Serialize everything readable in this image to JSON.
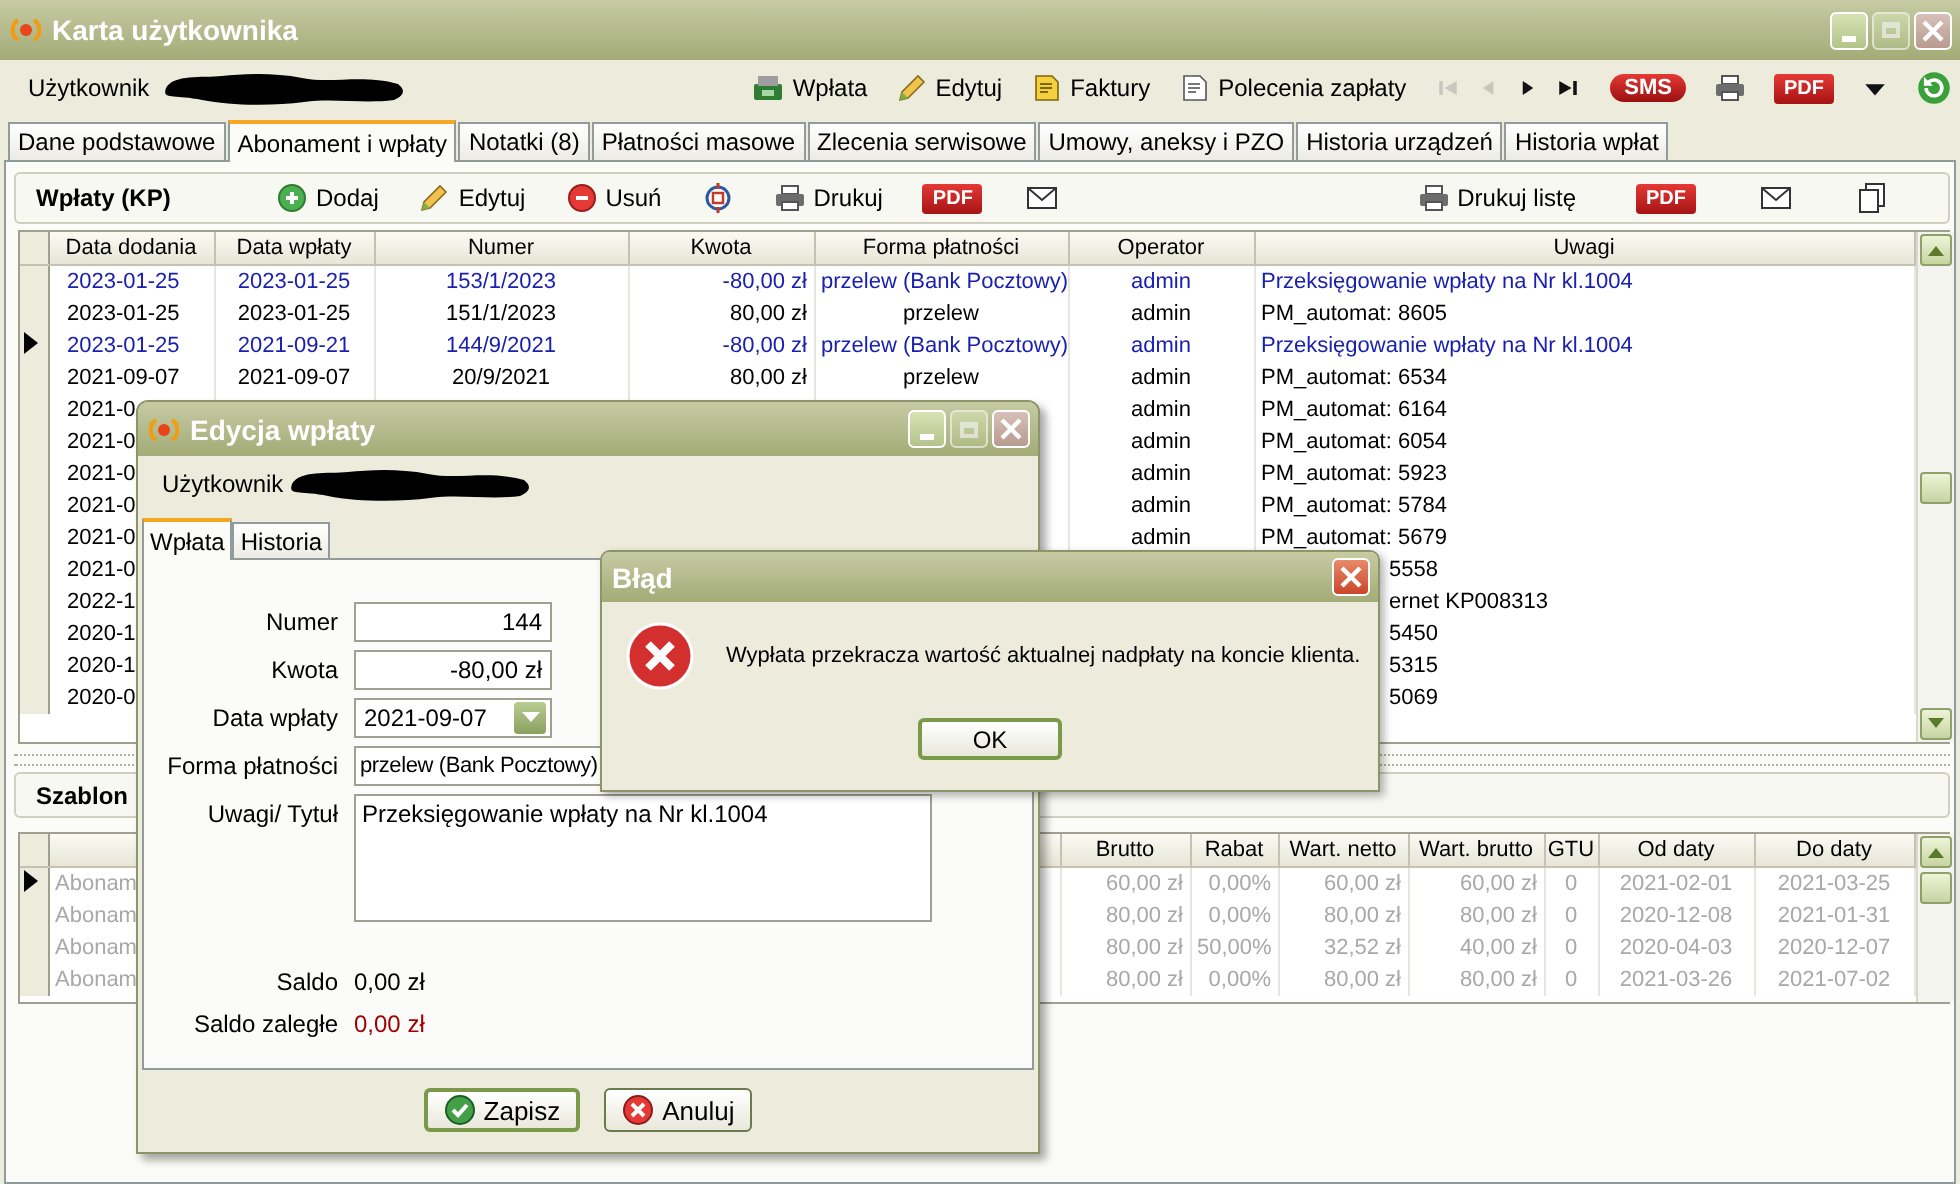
{
  "window": {
    "title": "Karta użytkownika"
  },
  "toolbar": {
    "user_label": "Użytkownik",
    "buttons": [
      {
        "kind": "payment",
        "label": "Wpłata"
      },
      {
        "kind": "edit",
        "label": "Edytuj"
      },
      {
        "kind": "invoices",
        "label": "Faktury"
      },
      {
        "kind": "orders",
        "label": "Polecenia zapłaty"
      }
    ],
    "nav_buttons": [
      {
        "kind": "first",
        "disabled": true
      },
      {
        "kind": "prev",
        "disabled": true
      },
      {
        "kind": "next",
        "disabled": false
      },
      {
        "kind": "last",
        "disabled": false
      }
    ],
    "sms_label": "SMS",
    "pdf_label": "PDF"
  },
  "tabs": [
    {
      "label": "Dane podstawowe",
      "selected": false
    },
    {
      "label": "Abonament i wpłaty",
      "selected": true
    },
    {
      "label": "Notatki (8)",
      "selected": false
    },
    {
      "label": "Płatności masowe",
      "selected": false
    },
    {
      "label": "Zlecenia serwisowe",
      "selected": false
    },
    {
      "label": "Umowy, aneksy i PZO",
      "selected": false
    },
    {
      "label": "Historia urządzeń",
      "selected": false
    },
    {
      "label": "Historia wpłat",
      "selected": false
    }
  ],
  "payments": {
    "title": "Wpłaty (KP)",
    "actions_left": [
      {
        "kind": "add",
        "label": "Dodaj"
      },
      {
        "kind": "edit",
        "label": "Edytuj"
      },
      {
        "kind": "delete",
        "label": "Usuń"
      },
      {
        "kind": "sync"
      },
      {
        "kind": "print",
        "label": "Drukuj"
      },
      {
        "kind": "pdf",
        "label": "PDF"
      },
      {
        "kind": "mail"
      }
    ],
    "actions_right": [
      {
        "kind": "print",
        "label": "Drukuj listę"
      },
      {
        "kind": "pdf",
        "label": "PDF"
      },
      {
        "kind": "mail"
      },
      {
        "kind": "copy"
      }
    ],
    "columns": [
      "Data dodania",
      "Data wpłaty",
      "Numer",
      "Kwota",
      "Forma płatności",
      "Operator",
      "Uwagi"
    ],
    "rows": [
      {
        "kind": "rebooking",
        "current": false,
        "cells": [
          "2023-01-25",
          "2023-01-25",
          "153/1/2023",
          "-80,00 zł",
          "przelew (Bank Pocztowy)",
          "admin",
          "Przeksięgowanie wpłaty na Nr kl.1004"
        ]
      },
      {
        "kind": "normal",
        "current": false,
        "cells": [
          "2023-01-25",
          "2023-01-25",
          "151/1/2023",
          "80,00 zł",
          "przelew",
          "admin",
          "PM_automat: 8605"
        ]
      },
      {
        "kind": "rebooking",
        "current": true,
        "cells": [
          "2023-01-25",
          "2021-09-21",
          "144/9/2021",
          "-80,00 zł",
          "przelew (Bank Pocztowy)",
          "admin",
          "Przeksięgowanie wpłaty na Nr kl.1004"
        ]
      },
      {
        "kind": "normal",
        "current": false,
        "cells": [
          "2021-09-07",
          "2021-09-07",
          "20/9/2021",
          "80,00 zł",
          "przelew",
          "admin",
          "PM_automat: 6534"
        ]
      },
      {
        "kind": "normal",
        "current": false,
        "cells": [
          "2021-0",
          null,
          null,
          null,
          null,
          "admin",
          "PM_automat: 6164"
        ]
      },
      {
        "kind": "normal",
        "current": false,
        "cells": [
          "2021-0",
          null,
          null,
          null,
          null,
          "admin",
          "PM_automat: 6054"
        ]
      },
      {
        "kind": "normal",
        "current": false,
        "cells": [
          "2021-0",
          null,
          null,
          null,
          null,
          "admin",
          "PM_automat: 5923"
        ]
      },
      {
        "kind": "normal",
        "current": false,
        "cells": [
          "2021-0",
          null,
          null,
          null,
          null,
          "admin",
          "PM_automat: 5784"
        ]
      },
      {
        "kind": "normal",
        "current": false,
        "cells": [
          "2021-0",
          null,
          null,
          null,
          null,
          "admin",
          "PM_automat: 5679"
        ]
      },
      {
        "kind": "normal",
        "current": false,
        "cells": [
          "2021-0",
          null,
          null,
          null,
          null,
          null,
          "5558"
        ]
      },
      {
        "kind": "normal",
        "current": false,
        "cells": [
          "2022-1",
          null,
          null,
          null,
          null,
          null,
          "ernet KP008313"
        ]
      },
      {
        "kind": "normal",
        "current": false,
        "cells": [
          "2020-1",
          null,
          null,
          null,
          null,
          null,
          "5450"
        ]
      },
      {
        "kind": "normal",
        "current": false,
        "cells": [
          "2020-1",
          null,
          null,
          null,
          null,
          null,
          "5315"
        ]
      },
      {
        "kind": "normal",
        "current": false,
        "cells": [
          "2020-0",
          null,
          null,
          null,
          null,
          null,
          "5069"
        ]
      }
    ]
  },
  "templates": {
    "title": "Szablon",
    "columns": [
      "",
      "Brutto",
      "Rabat",
      "Wart. netto",
      "Wart. brutto",
      "GTU",
      "Od daty",
      "Do daty"
    ],
    "rows": [
      {
        "current": true,
        "disabled": true,
        "cells": [
          "Abonam",
          "60,00 zł",
          "0,00%",
          "60,00 zł",
          "60,00 zł",
          "0",
          "2021-02-01",
          "2021-03-25"
        ]
      },
      {
        "current": false,
        "disabled": true,
        "cells": [
          "Abonam",
          "80,00 zł",
          "0,00%",
          "80,00 zł",
          "80,00 zł",
          "0",
          "2020-12-08",
          "2021-01-31"
        ]
      },
      {
        "current": false,
        "disabled": true,
        "cells": [
          "Abonam",
          "80,00 zł",
          "50,00%",
          "32,52 zł",
          "40,00 zł",
          "0",
          "2020-04-03",
          "2020-12-07"
        ]
      },
      {
        "current": false,
        "disabled": true,
        "cells": [
          "Abonam",
          "80,00 zł",
          "0,00%",
          "80,00 zł",
          "80,00 zł",
          "0",
          "2021-03-26",
          "2021-07-02"
        ]
      }
    ]
  },
  "edit_dialog": {
    "title": "Edycja wpłaty",
    "user_label": "Użytkownik",
    "tabs": [
      {
        "label": "Wpłata",
        "selected": true
      },
      {
        "label": "Historia",
        "selected": false
      }
    ],
    "fields": [
      {
        "kind": "text",
        "label": "Numer",
        "value": "144"
      },
      {
        "kind": "text",
        "label": "Kwota",
        "value": "-80,00 zł"
      },
      {
        "kind": "date",
        "label": "Data wpłaty",
        "value": "2021-09-07"
      },
      {
        "kind": "select",
        "label": "Forma płatności",
        "value": "przelew (Bank Pocztowy)"
      },
      {
        "kind": "memo",
        "label": "Uwagi/ Tytuł",
        "value": "Przeksięgowanie wpłaty na Nr kl.1004"
      }
    ],
    "summary": [
      {
        "label": "Saldo",
        "value": "0,00 zł",
        "overdue": false
      },
      {
        "label": "Saldo zaległe",
        "value": "0,00 zł",
        "overdue": true
      }
    ],
    "buttons": [
      {
        "kind": "save",
        "label": "Zapisz"
      },
      {
        "kind": "cancel",
        "label": "Anuluj"
      }
    ]
  },
  "error_dialog": {
    "title": "Błąd",
    "message": "Wypłata przekracza wartość aktualnej nadpłaty na koncie klienta.",
    "button": "OK"
  }
}
